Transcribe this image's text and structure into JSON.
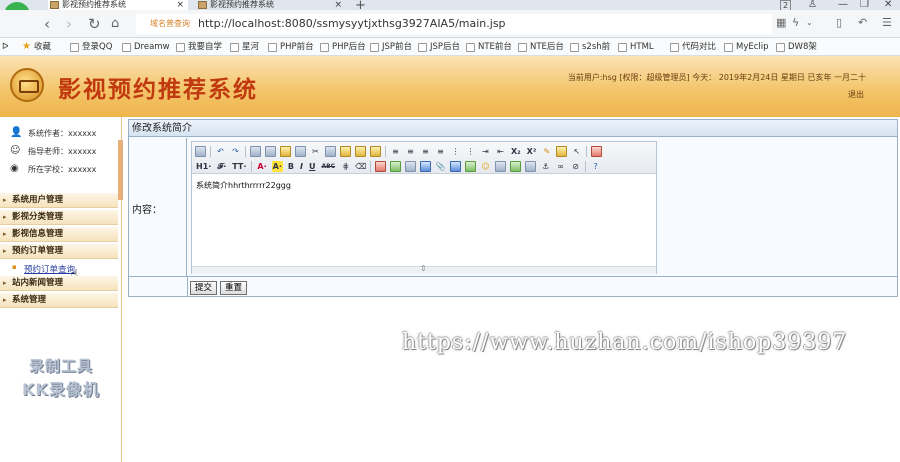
{
  "browser": {
    "tabs": [
      {
        "label": "影视预约推荐系统",
        "active": true
      },
      {
        "label": "影视预约推荐系统",
        "active": false
      }
    ],
    "new_tab": "+",
    "tab_close": "×",
    "tab_count": "2",
    "url_tag": "域名普查询",
    "url": "http://localhost:8080/ssmysyytjxthsg3927AIA5/main.jsp",
    "bookmarks": [
      "收藏",
      "登录QQ",
      "Dreamw",
      "我要自学",
      "星河",
      "PHP前台",
      "PHP后台",
      "JSP前台",
      "JSP后台",
      "NTE前台",
      "NTE后台",
      "s2sh前",
      "HTML",
      "代码对比",
      "MyEclip",
      "DW8架"
    ]
  },
  "app": {
    "title": "影视预约推荐系统",
    "user_info": "当前用户:hsg [权限：超级管理员]  今天：  2019年2月24日 星期日 已亥年 一月二十",
    "logout": "退出"
  },
  "sidebar": {
    "info": [
      {
        "label": "系统作者：xxxxxx",
        "icon": "person-icon"
      },
      {
        "label": "指导老师：xxxxxx",
        "icon": "teacher-icon"
      },
      {
        "label": "所在学校：xxxxxx",
        "icon": "school-icon"
      }
    ],
    "menus": [
      "系统用户管理",
      "影视分类管理",
      "影视信息管理",
      "预约订单管理",
      "站内新闻管理",
      "系统管理"
    ],
    "active_submenu": "预约订单查询",
    "watermark": [
      "录制工具",
      "KK录像机"
    ]
  },
  "form": {
    "panel_title": "修改系统简介",
    "content_label": "内容：",
    "editor_text": "系统简介hhrthrrrrr22ggg",
    "submit_label": "提交",
    "reset_label": "重置",
    "toolbar_text": [
      "H1·",
      "𝓕·",
      "TT·",
      "A·",
      "A·",
      "B",
      "I",
      "U",
      "ABC",
      "X₂",
      "X²"
    ]
  },
  "overlay_watermark": "https://www.huzhan.com/ishop39397"
}
